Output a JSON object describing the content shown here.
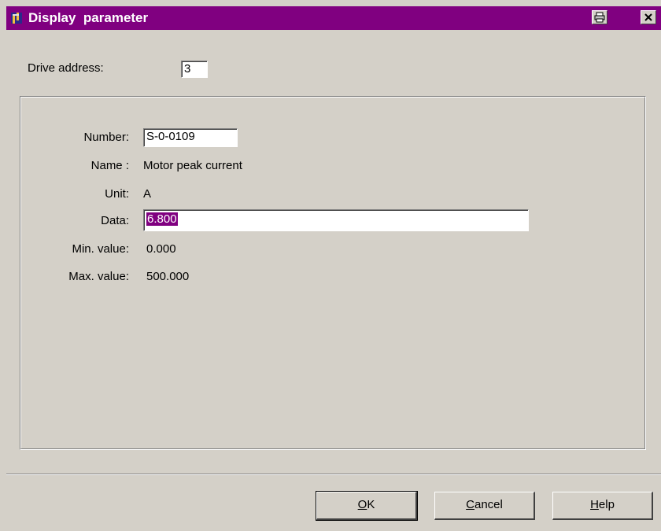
{
  "window": {
    "title": "Display  parameter",
    "colors": {
      "titlebar": "#800080",
      "face": "#d4d0c8",
      "selection": "#800080"
    },
    "icons": {
      "app": "app-icon",
      "print": "printer-icon",
      "close": "close-icon"
    }
  },
  "drive": {
    "label": "Drive address:",
    "value": "3"
  },
  "parameter": {
    "number_label": "Number:",
    "number_value": "S-0-0109",
    "name_label": "Name :",
    "name_value": "Motor peak current",
    "unit_label": "Unit:",
    "unit_value": "A",
    "data_label": "Data:",
    "data_value": "6.800",
    "min_label": "Min. value:",
    "min_value": "0.000",
    "max_label": "Max. value:",
    "max_value": "500.000"
  },
  "buttons": {
    "ok_mnemonic": "O",
    "ok_rest": "K",
    "cancel_mnemonic": "C",
    "cancel_rest": "ancel",
    "help_mnemonic": "H",
    "help_rest": "elp"
  }
}
